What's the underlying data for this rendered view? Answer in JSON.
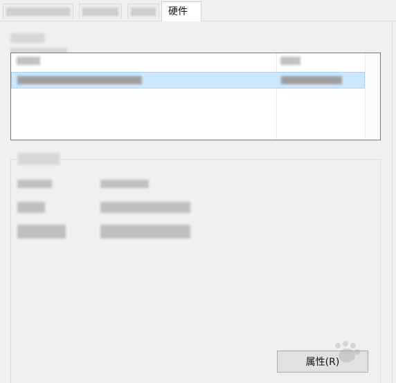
{
  "tabs": [
    {
      "label": ""
    },
    {
      "label": ""
    },
    {
      "label": ""
    },
    {
      "label": "硬件"
    }
  ],
  "buttons": {
    "properties_label": "属性(R)"
  }
}
